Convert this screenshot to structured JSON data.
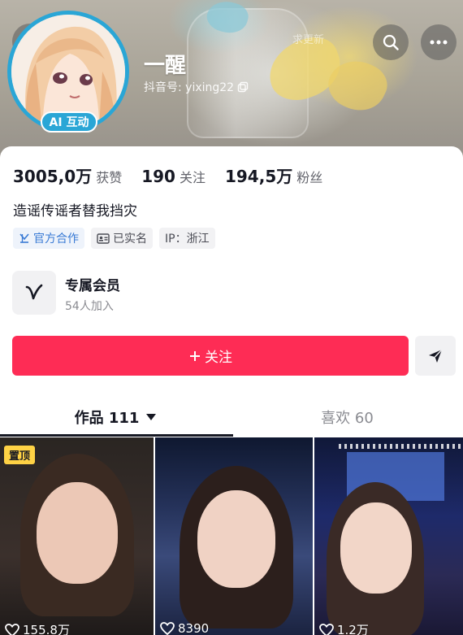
{
  "header": {
    "nickname": "一醒",
    "account_label": "抖音号: yixing22",
    "ai_badge": "AI 互动",
    "ghost_text": "求更新"
  },
  "stats": [
    {
      "value": "3005,0万",
      "label": "获赞"
    },
    {
      "value": "190",
      "label": "关注"
    },
    {
      "value": "194,5万",
      "label": "粉丝"
    }
  ],
  "bio": "造谣传谣者替我挡灾",
  "tags": {
    "official": "官方合作",
    "verified": "已实名",
    "ip": "IP：浙江"
  },
  "vip": {
    "title": "专属会员",
    "subtitle": "54人加入"
  },
  "actions": {
    "follow_label": "关注"
  },
  "tabs": {
    "works_label": "作品 111",
    "likes_label": "喜欢 60"
  },
  "videos": [
    {
      "badge": "置顶",
      "plays": "155.8万"
    },
    {
      "plays": "8390"
    },
    {
      "plays": "1.2万"
    }
  ],
  "colors": {
    "accent": "#fe2c55",
    "ai_badge": "#2aa6d6",
    "pinned": "#fed245"
  },
  "icons": [
    "back-icon",
    "search-icon",
    "more-icon",
    "copy-icon",
    "official-icon",
    "id-card-icon",
    "vip-logo-icon",
    "plus-icon",
    "share-icon",
    "caret-down-icon",
    "heart-icon"
  ]
}
